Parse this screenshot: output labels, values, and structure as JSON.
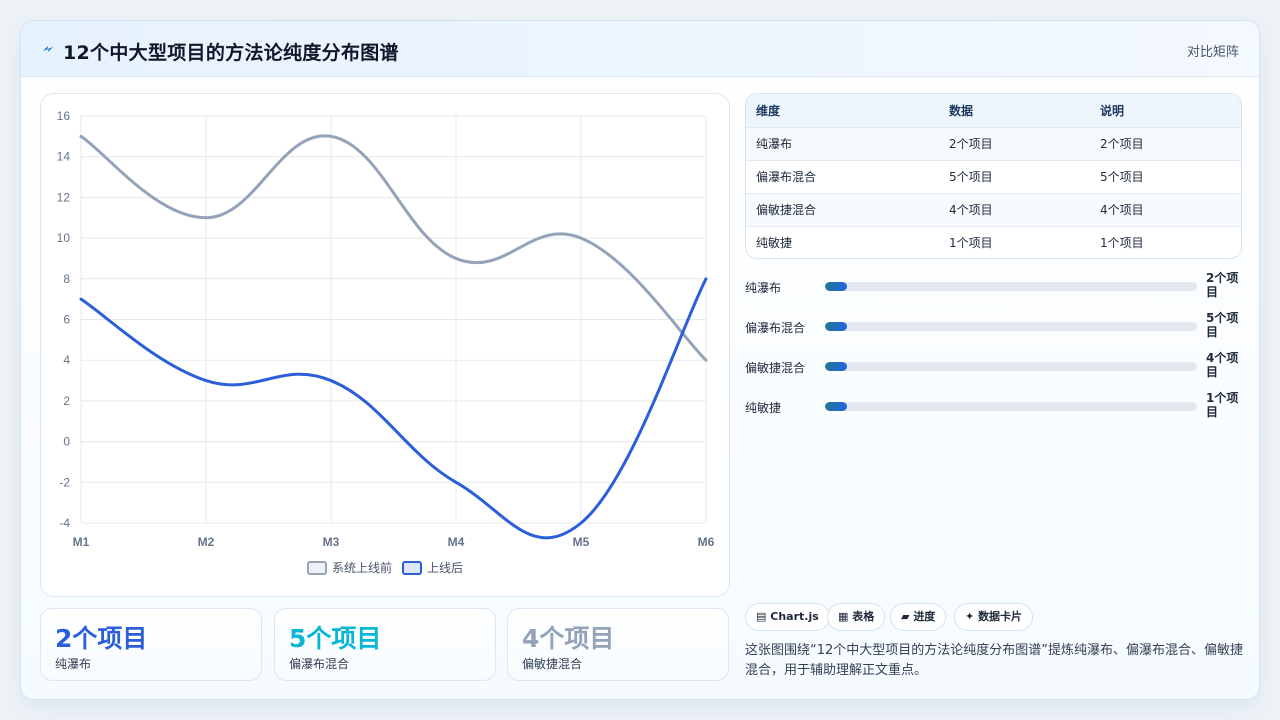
{
  "header": {
    "title": "12个中大型项目的方法论纯度分布图谱",
    "compare_label": "对比矩阵",
    "icon": "lightning-icon"
  },
  "chart_data": {
    "type": "line",
    "x": [
      "M1",
      "M2",
      "M3",
      "M4",
      "M5",
      "M6"
    ],
    "ylim": [
      -4,
      16
    ],
    "yticks": [
      -4,
      -2,
      0,
      2,
      4,
      6,
      8,
      10,
      12,
      14,
      16
    ],
    "grid": true,
    "legend_position": "bottom",
    "series": [
      {
        "name": "系统上线前",
        "values": [
          15,
          11,
          15,
          9,
          10,
          4
        ],
        "color": "#94a3b8"
      },
      {
        "name": "上线后",
        "values": [
          7,
          3,
          3,
          -2,
          -4,
          8
        ],
        "color": "#2b5fd9"
      }
    ]
  },
  "stats": [
    {
      "value": "2个项目",
      "label": "纯瀑布",
      "color": "#2b5fd9"
    },
    {
      "value": "5个项目",
      "label": "偏瀑布混合",
      "color": "#06b6d4"
    },
    {
      "value": "4个项目",
      "label": "偏敏捷混合",
      "color": "#94a3b8"
    }
  ],
  "table": {
    "headers": [
      "维度",
      "数据",
      "说明"
    ],
    "rows": [
      [
        "纯瀑布",
        "2个项目",
        "2个项目"
      ],
      [
        "偏瀑布混合",
        "5个项目",
        "5个项目"
      ],
      [
        "偏敏捷混合",
        "4个项目",
        "4个项目"
      ],
      [
        "纯敏捷",
        "1个项目",
        "1个项目"
      ]
    ]
  },
  "progress": [
    {
      "label": "纯瀑布",
      "value": "2个项目",
      "fill_percent": 6
    },
    {
      "label": "偏瀑布混合",
      "value": "5个项目",
      "fill_percent": 6
    },
    {
      "label": "偏敏捷混合",
      "value": "4个项目",
      "fill_percent": 6
    },
    {
      "label": "纯敏捷",
      "value": "1个项目",
      "fill_percent": 6
    }
  ],
  "chips": [
    {
      "icon": "chart-icon",
      "glyph": "▤",
      "label": "Chart.js"
    },
    {
      "icon": "table-icon",
      "glyph": "▦",
      "label": "表格"
    },
    {
      "icon": "progress-icon",
      "glyph": "▰",
      "label": "进度"
    },
    {
      "icon": "sparkle-icon",
      "glyph": "✦",
      "label": "数据卡片"
    }
  ],
  "description": "这张图围绕“12个中大型项目的方法论纯度分布图谱”提炼纯瀑布、偏瀑布混合、偏敏捷混合，用于辅助理解正文重点。"
}
